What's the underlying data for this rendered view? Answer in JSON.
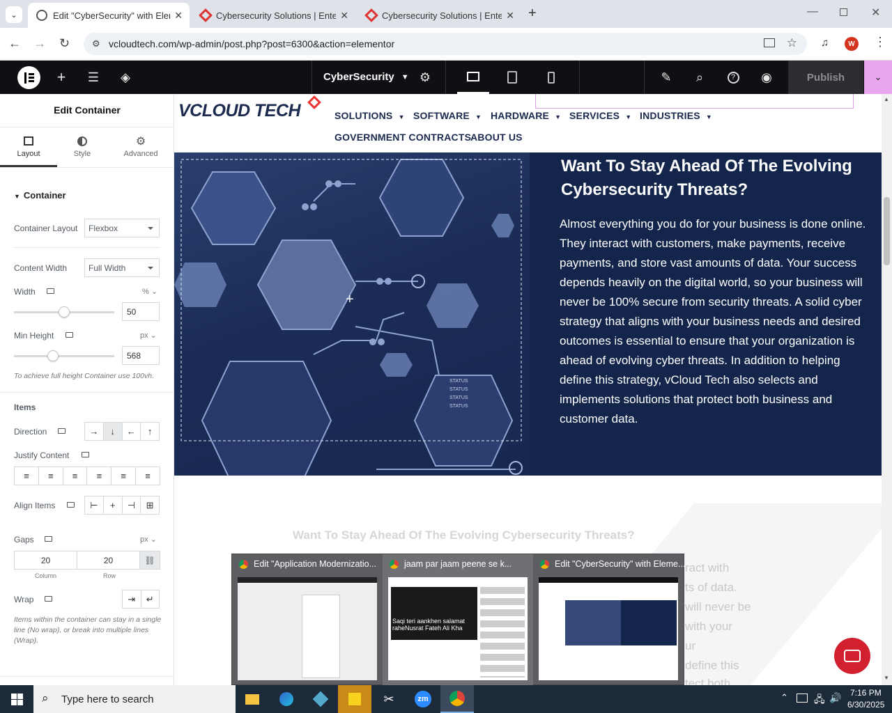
{
  "browser": {
    "tabs": [
      {
        "title": "Edit \"CyberSecurity\" with Eleme",
        "active": true
      },
      {
        "title": "Cybersecurity Solutions | Enterp",
        "active": false
      },
      {
        "title": "Cybersecurity Solutions | Enterp",
        "active": false
      }
    ],
    "url": "vcloudtech.com/wp-admin/post.php?post=6300&action=elementor",
    "profile_initial": "W"
  },
  "elementor": {
    "page_name": "CyberSecurity",
    "publish_label": "Publish"
  },
  "panel": {
    "title": "Edit Container",
    "tabs": [
      "Layout",
      "Style",
      "Advanced"
    ],
    "section_title": "Container",
    "container_layout_label": "Container Layout",
    "container_layout_value": "Flexbox",
    "content_width_label": "Content Width",
    "content_width_value": "Full Width",
    "width_label": "Width",
    "width_unit": "%",
    "width_value": "50",
    "width_fraction": 0.5,
    "min_height_label": "Min Height",
    "min_height_unit": "px",
    "min_height_value": "568",
    "min_height_fraction": 0.39,
    "min_height_hint": "To achieve full height Container use 100vh.",
    "items_heading": "Items",
    "direction_label": "Direction",
    "justify_label": "Justify Content",
    "align_label": "Align Items",
    "gaps_label": "Gaps",
    "gaps_unit": "px",
    "gap_column": "20",
    "gap_row": "20",
    "gap_column_label": "Column",
    "gap_row_label": "Row",
    "wrap_label": "Wrap",
    "wrap_hint": "Items within the container can stay in a single line (No wrap), or break into multiple lines (Wrap)."
  },
  "site": {
    "logo": "VCLOUD TECH",
    "nav": [
      "SOLUTIONS",
      "SOFTWARE",
      "HARDWARE",
      "SERVICES",
      "INDUSTRIES",
      "GOVERNMENT CONTRACTS",
      "ABOUT US"
    ],
    "hero_title": "Want To Stay Ahead Of The Evolving Cybersecurity Threats?",
    "hero_body": "Almost everything you do for your business is done online. They interact with customers, make payments, receive payments, and store vast amounts of data. Your success depends heavily on the digital world, so your business will never be 100% secure from security threats. A solid cyber strategy that aligns with your business needs and desired outcomes is essential to ensure that your organization is ahead of evolving cyber threats. In addition to helping define this strategy, vCloud Tech also selects and implements solutions that protect both business and customer data.",
    "hero_image_texts": [
      "STATUS",
      "STATUS",
      "STATUS",
      "STATUS"
    ],
    "lower_title": "Want To Stay Ahead Of The Evolving Cybersecurity Threats?",
    "lower_fragments": [
      "ract with",
      "ts of data.",
      "will never be",
      "with your",
      "ur",
      "define this",
      "tect both"
    ]
  },
  "taskbar_preview": [
    {
      "title": "Edit \"Application Modernizatio..."
    },
    {
      "title": "jaam par jaam peene se k...",
      "caption": "Saqi teri aankhen salamat raheNusrat Fateh Ali Kha"
    },
    {
      "title": "Edit \"CyberSecurity\" with Eleme..."
    }
  ],
  "taskbar": {
    "search_placeholder": "Type here to search",
    "time": "7:16 PM",
    "date": "6/30/2025"
  },
  "colors": {
    "elementor_dark": "#0f1013",
    "accent_pink": "#e7a6ee",
    "hero_navy": "#14254c",
    "chat_red": "#d3202f"
  }
}
